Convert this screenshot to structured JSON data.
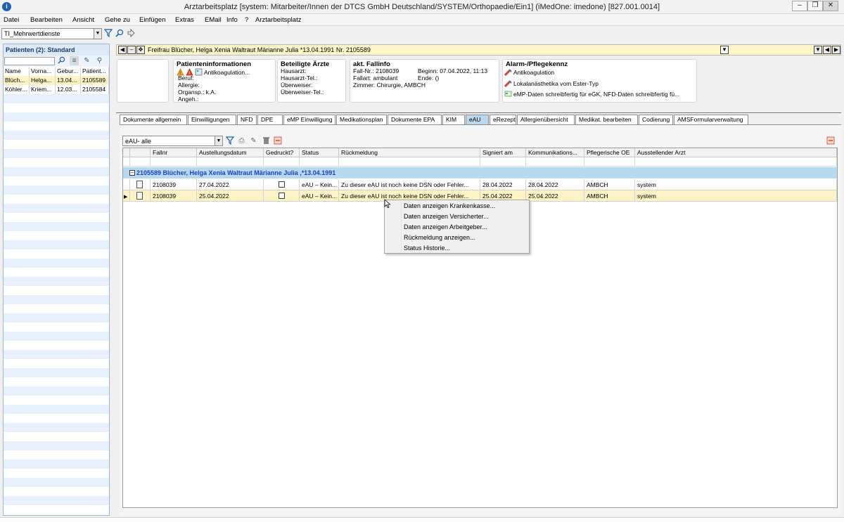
{
  "window": {
    "title": "Arztarbeitsplatz [system: Mitarbeiter/Innen der DTCS GmbH Deutschland/SYSTEM/Orthopaedie/Ein1] (iMedOne: imedone) [827.001.0014]",
    "app_icon": "info-icon",
    "buttons": [
      "minimize",
      "restore",
      "close"
    ]
  },
  "menu": [
    "Datei",
    "Bearbeiten",
    "Ansicht",
    "Gehe zu",
    "Einfügen",
    "Extras",
    "EMail",
    "Info",
    "?",
    "Arztarbeitsplatz"
  ],
  "toolbar": {
    "combo_value": "TI_Mehrwertdienste",
    "icons": [
      "filter-icon",
      "search-icon",
      "forward-icon"
    ]
  },
  "patients_panel": {
    "title": "Patienten (2): Standard",
    "columns": [
      "Name",
      "Vorna...",
      "Gebur...",
      "Patient..."
    ],
    "rows": [
      [
        "Blüch...",
        "Helga...",
        "13.04...",
        "2105589"
      ],
      [
        "Köhler...",
        "Kriem...",
        "12.03...",
        "2105584"
      ]
    ]
  },
  "patient_bar": {
    "text": "Freifrau Blücher, Helga Xenia Waltraut Märianne Julia *13.04.1991 Nr. 2105589"
  },
  "cards": {
    "patient_info": {
      "title": "Patienteninformationen",
      "alert": "Antikoagulation...",
      "lines": [
        "Beruf:",
        "Allergie:",
        "Organsp.: k.A.",
        "Angeh.:"
      ]
    },
    "doctors": {
      "title": "Beteiligte Ärzte",
      "lines": [
        "Hausarzt:",
        "Hausarzt-Tel.:",
        "Überweiser:",
        "Überweiser-Tel.:"
      ]
    },
    "case": {
      "title": "akt. Fallinfo",
      "lines_left": [
        "Fall-Nr.: 2108039",
        "Fallart: ambulant",
        "Zimmer: Chirurgie, AMBCH"
      ],
      "lines_right": [
        "Beginn: 07.04.2022, 11:13",
        "Ende: ()"
      ]
    },
    "alarm": {
      "title": "Alarm-/Pflegekennz",
      "lines": [
        "Antikoagulation",
        "Lokalanästhetika vom Ester-Typ",
        "eMP-Daten schreibfertig für eGK, NFD-Daten schreibfertig fü..."
      ]
    }
  },
  "tabs": [
    "Dokumente allgemein",
    "Einwilligungen",
    "NFD",
    "DPE",
    "eMP Einwilligung",
    "Medikationsplan",
    "Dokumente EPA",
    "KIM",
    "eAU",
    "eRezept",
    "Allergienübersicht",
    "Medikat. bearbeiten",
    "Codierung",
    "AMSFormularverwaltung"
  ],
  "active_tab": "eAU",
  "eau": {
    "filter_value": "eAU- alle",
    "columns": [
      "",
      "Fallnr",
      "Austellungsdatum",
      "Gedruckt?",
      "Status",
      "Rückmeldung",
      "Signiert am",
      "Kommunikations...",
      "Pflegerische OE",
      "Ausstellender Arzt"
    ],
    "group_label": "2105589 Blücher, Helga Xenia Waltraut Märianne Julia ,*13.04.1991",
    "rows": [
      {
        "fallnr": "2108039",
        "datum": "27.04.2022",
        "status": "eAU – Kein...",
        "rueckmeldung": "Zu dieser eAU ist noch keine DSN oder Fehler...",
        "signiert": "28.04.2022",
        "kommunikation": "28.04.2022",
        "oe": "AMBCH",
        "arzt": "system"
      },
      {
        "fallnr": "2108039",
        "datum": "25.04.2022",
        "status": "eAU – Kein...",
        "rueckmeldung": "Zu dieser eAU ist noch keine DSN oder Fehler...",
        "signiert": "25.04.2022",
        "kommunikation": "25.04.2022",
        "oe": "AMBCH",
        "arzt": "system"
      }
    ]
  },
  "context_menu": [
    "Daten anzeigen Krankenkasse...",
    "Daten anzeigen Versicherter...",
    "Daten anzeigen Arbeitgeber...",
    "Rückmeldung anzeigen...",
    "Status Historie..."
  ],
  "colors": {
    "selected_row": "#fdf3c4",
    "group_row": "#b6d9f0",
    "active_tab": "#bdd7ee",
    "group_text": "#1f3fbf"
  }
}
